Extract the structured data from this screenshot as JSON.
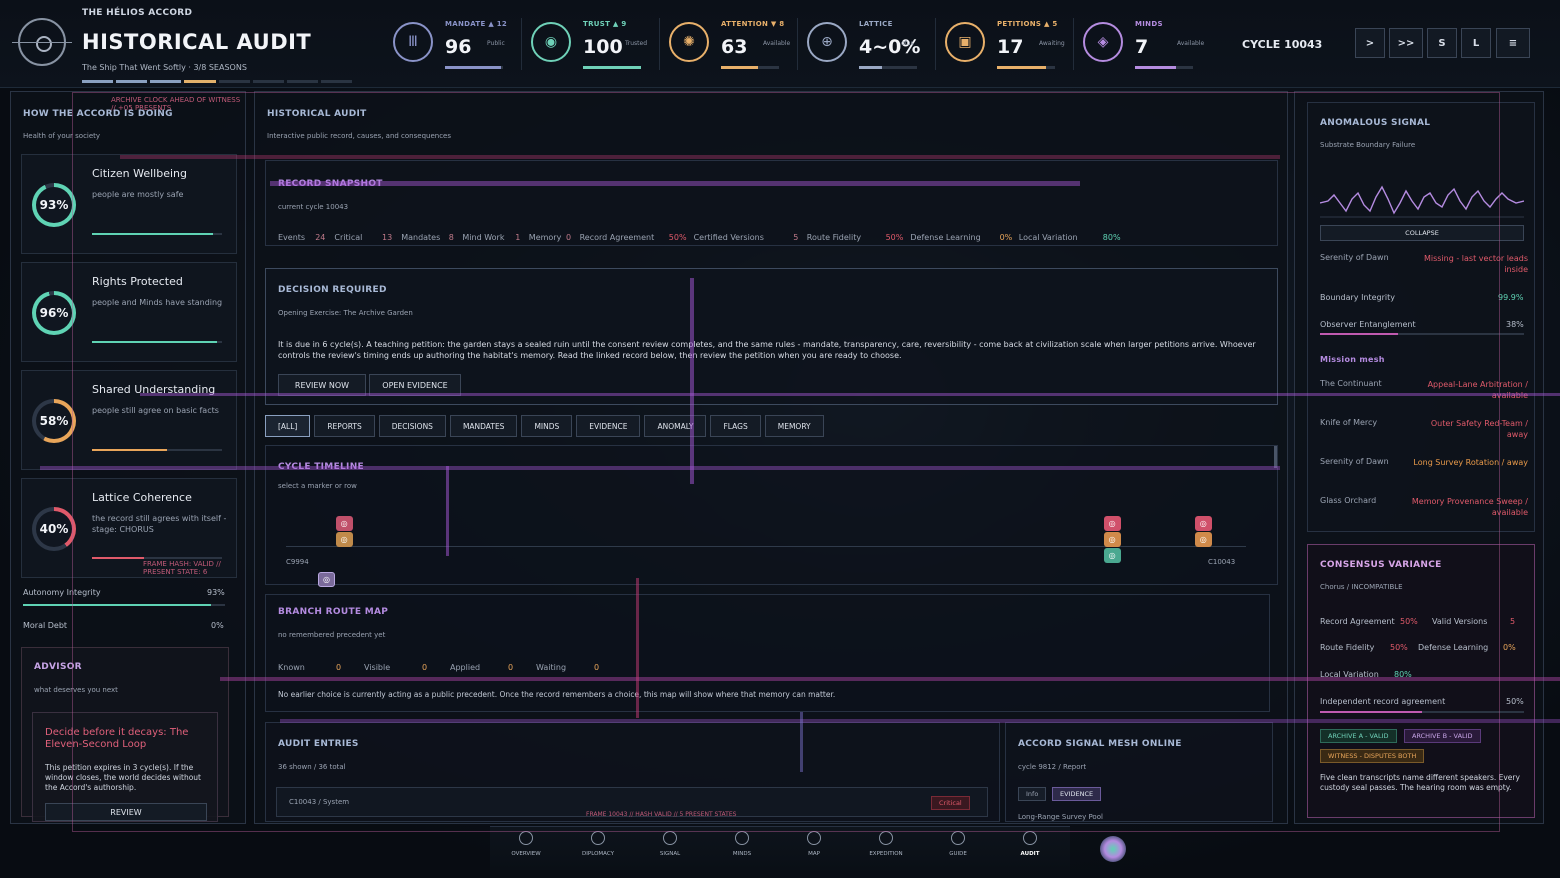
{
  "header": {
    "app_name": "THE HÉLIOS ACCORD",
    "title": "HISTORICAL AUDIT",
    "subtitle": "The Ship That Went Softly · 3/8 SEASONS",
    "cycle": "CYCLE 10043"
  },
  "stats": [
    {
      "label": "MANDATE ▲ 12",
      "value": "96",
      "sub": "Public",
      "color": "#8a93c8",
      "icon": "pillar-icon",
      "glyph": "Ⅲ",
      "fill": 0.96
    },
    {
      "label": "TRUST ▲ 9",
      "value": "100",
      "sub": "Trusted",
      "color": "#6fd1b8",
      "icon": "eye-icon",
      "glyph": "◉",
      "fill": 1.0
    },
    {
      "label": "ATTENTION ▼ 8",
      "value": "63",
      "sub": "Available",
      "color": "#e8b06a",
      "icon": "compass-icon",
      "glyph": "✺",
      "fill": 0.63
    },
    {
      "label": "LATTICE",
      "value": "4~0%",
      "sub": "ofus",
      "color": "#9aa8c4",
      "icon": "lattice-icon",
      "glyph": "⊕",
      "fill": 0.4
    },
    {
      "label": "PETITIONS ▲ 5",
      "value": "17",
      "sub": "Awaiting",
      "color": "#e8b06a",
      "icon": "scroll-icon",
      "glyph": "▣",
      "fill": 0.85
    },
    {
      "label": "MINDS",
      "value": "7",
      "sub": "Available",
      "color": "#b58ce0",
      "icon": "mind-icon",
      "glyph": "◈",
      "fill": 0.7
    }
  ],
  "controls": [
    ">",
    ">>",
    "S",
    "L",
    "≡"
  ],
  "left": {
    "warning": "ARCHIVE CLOCK AHEAD OF WITNESS // +05 PRESENTS",
    "title": "HOW THE ACCORD IS DOING",
    "subtitle": "Health of your society",
    "metrics": [
      {
        "name": "Citizen Wellbeing",
        "value": "93%",
        "desc": "people are mostly safe",
        "color": "#5fd3b4",
        "fill": 0.93
      },
      {
        "name": "Rights Protected",
        "value": "96%",
        "desc": "people and Minds have standing",
        "color": "#5fd3b4",
        "fill": 0.96
      },
      {
        "name": "Shared Understanding",
        "value": "58%",
        "desc": "people still agree on basic facts",
        "color": "#e8a55a",
        "fill": 0.58
      },
      {
        "name": "Lattice Coherence",
        "value": "40%",
        "desc": "the record still agrees with itself - stage: CHORUS",
        "color": "#e05a6a",
        "fill": 0.4
      }
    ],
    "frame_hash": "FRAME HASH: VALID  //  PRESENT STATE: 6",
    "autonomy_label": "Autonomy Integrity",
    "autonomy_value": "93%",
    "debt_label": "Moral Debt",
    "debt_value": "0%",
    "advisor": {
      "title": "ADVISOR",
      "subtitle": "what deserves you next",
      "card_title": "Decide before it decays: The Eleven-Second Loop",
      "card_body": "This petition expires in 3 cycle(s). If the window closes, the world decides without the Accord's authorship.",
      "button": "REVIEW"
    }
  },
  "center": {
    "title": "HISTORICAL AUDIT",
    "subtitle": "Interactive public record, causes, and consequences",
    "snapshot": {
      "title": "RECORD SNAPSHOT",
      "cycle": "current cycle 10043",
      "items": [
        {
          "k": "Events",
          "v": "24"
        },
        {
          "k": "Critical",
          "v": "13"
        },
        {
          "k": "Mandates",
          "v": "8"
        },
        {
          "k": "Mind Work",
          "v": "1"
        },
        {
          "k": "Memory",
          "v": "0"
        },
        {
          "k": "Record Agreement",
          "v": "50%"
        },
        {
          "k": "Certified Versions",
          "v": "5"
        },
        {
          "k": "Route Fidelity",
          "v": "50%"
        },
        {
          "k": "Defense Learning",
          "v": "0%"
        },
        {
          "k": "Local Variation",
          "v": "80%"
        }
      ]
    },
    "decision": {
      "title": "DECISION REQUIRED",
      "exercise": "Opening Exercise: The Archive Garden",
      "body": "It is due in 6 cycle(s). A teaching petition: the garden stays a sealed ruin until the consent review completes, and the same rules - mandate, transparency, care, reversibility - come back at civilization scale when larger petitions arrive. Whoever controls the review's timing ends up authoring the habitat's memory. Read the linked record below, then review the petition when you are ready to choose.",
      "btn_review": "REVIEW NOW",
      "btn_evidence": "OPEN EVIDENCE"
    },
    "filters": [
      "[ALL]",
      "REPORTS",
      "DECISIONS",
      "MANDATES",
      "MINDS",
      "EVIDENCE",
      "ANOMALY",
      "FLAGS",
      "MEMORY"
    ],
    "timeline": {
      "title": "CYCLE TIMELINE",
      "hint": "select a marker or row",
      "start": "C9994",
      "end": "C10043",
      "markers": [
        {
          "name": "timeline-marker-c9994",
          "frac": 0.06,
          "colors": [
            "#c0506a",
            "#c08a4a"
          ]
        },
        {
          "name": "timeline-marker-c10029",
          "frac": 0.86,
          "colors": [
            "#d0506a",
            "#d08a4a",
            "#4aa890"
          ]
        },
        {
          "name": "timeline-marker-c10038",
          "frac": 0.955,
          "colors": [
            "#d0506a",
            "#d08a4a"
          ]
        }
      ]
    },
    "route": {
      "title": "BRANCH ROUTE MAP",
      "subtitle": "no remembered precedent yet",
      "stats": [
        {
          "k": "Known",
          "v": "0"
        },
        {
          "k": "Visible",
          "v": "0"
        },
        {
          "k": "Applied",
          "v": "0"
        },
        {
          "k": "Waiting",
          "v": "0"
        }
      ],
      "note": "No earlier choice is currently acting as a public precedent. Once the record remembers a choice, this map will show where that memory can matter."
    },
    "audit": {
      "title": "AUDIT ENTRIES",
      "count": "36 shown / 36 total",
      "row_id": "C10043 / System",
      "row_badge": "Critical",
      "footer": "FRAME 10043 // HASH VALID // 5 PRESENT STATES"
    },
    "mesh": {
      "title": "ACCORD SIGNAL MESH ONLINE",
      "subtitle": "cycle 9812 / Report",
      "tag1": "Info",
      "tag2": "EVIDENCE",
      "cut_text": "Long-Range Survey Pool"
    }
  },
  "right": {
    "signal": {
      "title": "ANOMALOUS SIGNAL",
      "subtitle": "Substrate Boundary Failure",
      "collapse": "COLLAPSE",
      "rows": [
        {
          "k": "Serenity of Dawn",
          "v": "Missing - last vector leads inside",
          "tone": "red"
        }
      ],
      "boundary_label": "Boundary Integrity",
      "boundary_value": "99.9%",
      "observer_label": "Observer Entanglement",
      "observer_value": "38%",
      "mesh_title": "Mission mesh",
      "mesh": [
        {
          "k": "The Continuant",
          "v": "Appeal-Lane Arbitration / available",
          "tone": "red"
        },
        {
          "k": "Knife of Mercy",
          "v": "Outer Safety Red-Team / away",
          "tone": "red"
        },
        {
          "k": "Serenity of Dawn",
          "v": "Long Survey Rotation / away",
          "tone": "orange"
        },
        {
          "k": "Glass Orchard",
          "v": "Memory Provenance Sweep / available",
          "tone": "red"
        }
      ]
    },
    "variance": {
      "title": "CONSENSUS VARIANCE",
      "subtitle": "Chorus / INCOMPATIBLE",
      "record_agreement_label": "Record Agreement",
      "record_agreement": "50%",
      "valid_versions_label": "Valid Versions",
      "valid_versions": "5",
      "route_fidelity_label": "Route Fidelity",
      "route_fidelity": "50%",
      "defense_learning_label": "Defense Learning",
      "defense_learning": "0%",
      "local_variation_label": "Local Variation",
      "local_variation": "80%",
      "independent_label": "Independent record agreement",
      "independent_value": "50%",
      "badges": [
        "ARCHIVE A - VALID",
        "ARCHIVE B - VALID",
        "WITNESS - DISPUTES BOTH"
      ],
      "note": "Five clean transcripts name different speakers. Every custody seal passes. The hearing room was empty."
    }
  },
  "nav": [
    "OVERVIEW",
    "DIPLOMACY",
    "SIGNAL",
    "MINDS",
    "MAP",
    "EXPEDITION",
    "GUIDE",
    "AUDIT"
  ],
  "colors": {
    "accent": "#a8b9d6",
    "purple": "#b48be0",
    "critical": "#e05a6a",
    "warning": "#e8a55a",
    "good": "#5fd3b4"
  }
}
